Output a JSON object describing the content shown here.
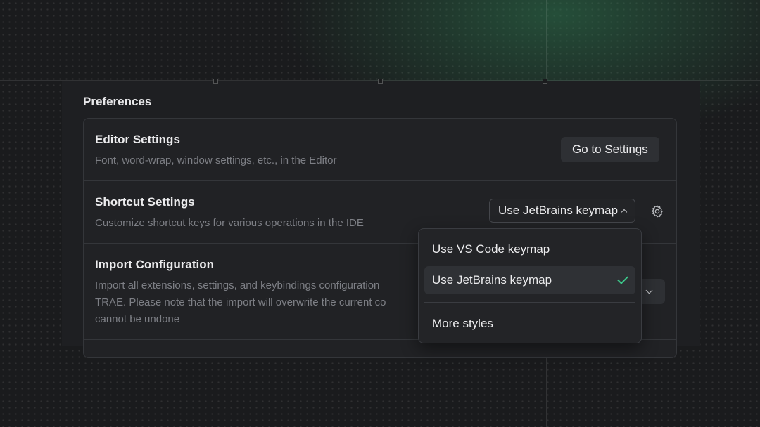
{
  "preferences": {
    "title": "Preferences",
    "editor_settings": {
      "title": "Editor Settings",
      "description": "Font, word-wrap, window settings, etc., in the Editor",
      "button_label": "Go to Settings"
    },
    "shortcut_settings": {
      "title": "Shortcut Settings",
      "description": "Customize shortcut keys for various operations in the IDE",
      "selected_keymap": "Use JetBrains keymap"
    },
    "import_configuration": {
      "title": "Import Configuration",
      "description_line1": "Import all extensions, settings, and keybindings configuration",
      "description_line2": "TRAE. Please note that the import will overwrite the current co",
      "description_line3": "cannot be undone"
    }
  },
  "keymap_dropdown": {
    "options": [
      "Use VS Code keymap",
      "Use JetBrains keymap"
    ],
    "selected_index": 1,
    "more_label": "More styles",
    "check_icon": "check-icon",
    "accent_color": "#3cc78a"
  },
  "icons": {
    "gear": "gear-icon",
    "chevron_up": "chevron-up-icon",
    "chevron_down": "chevron-down-icon"
  }
}
